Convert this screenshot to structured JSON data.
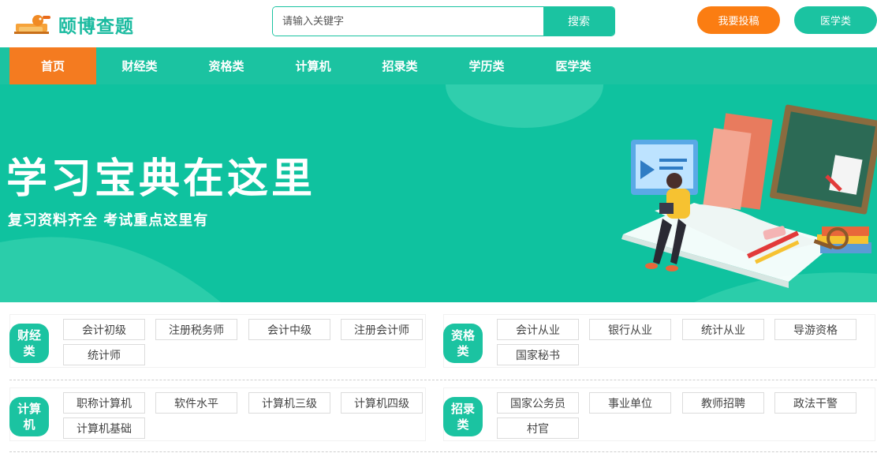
{
  "header": {
    "logo_text": "颐博查题",
    "search_placeholder": "请输入关键字",
    "search_button": "搜索",
    "submit_button": "我要投稿",
    "medical_button": "医学类"
  },
  "nav": {
    "items": [
      "首页",
      "财经类",
      "资格类",
      "计算机",
      "招录类",
      "学历类",
      "医学类"
    ],
    "active_index": 0
  },
  "banner": {
    "headline": "学习宝典在这里",
    "subheadline": "复习资料齐全 考试重点这里有"
  },
  "categories": [
    {
      "badge": "财经类",
      "tags": [
        "会计初级",
        "注册税务师",
        "会计中级",
        "注册会计师",
        "统计师"
      ]
    },
    {
      "badge": "资格类",
      "tags": [
        "会计从业",
        "银行从业",
        "统计从业",
        "导游资格",
        "国家秘书"
      ]
    },
    {
      "badge": "计算机",
      "tags": [
        "职称计算机",
        "软件水平",
        "计算机三级",
        "计算机四级",
        "计算机基础"
      ]
    },
    {
      "badge": "招录类",
      "tags": [
        "国家公务员",
        "事业单位",
        "教师招聘",
        "政法干警",
        "村官"
      ]
    }
  ],
  "colors": {
    "primary": "#1bc3a1",
    "accent": "#f47b20",
    "banner": "#0fc29f"
  }
}
